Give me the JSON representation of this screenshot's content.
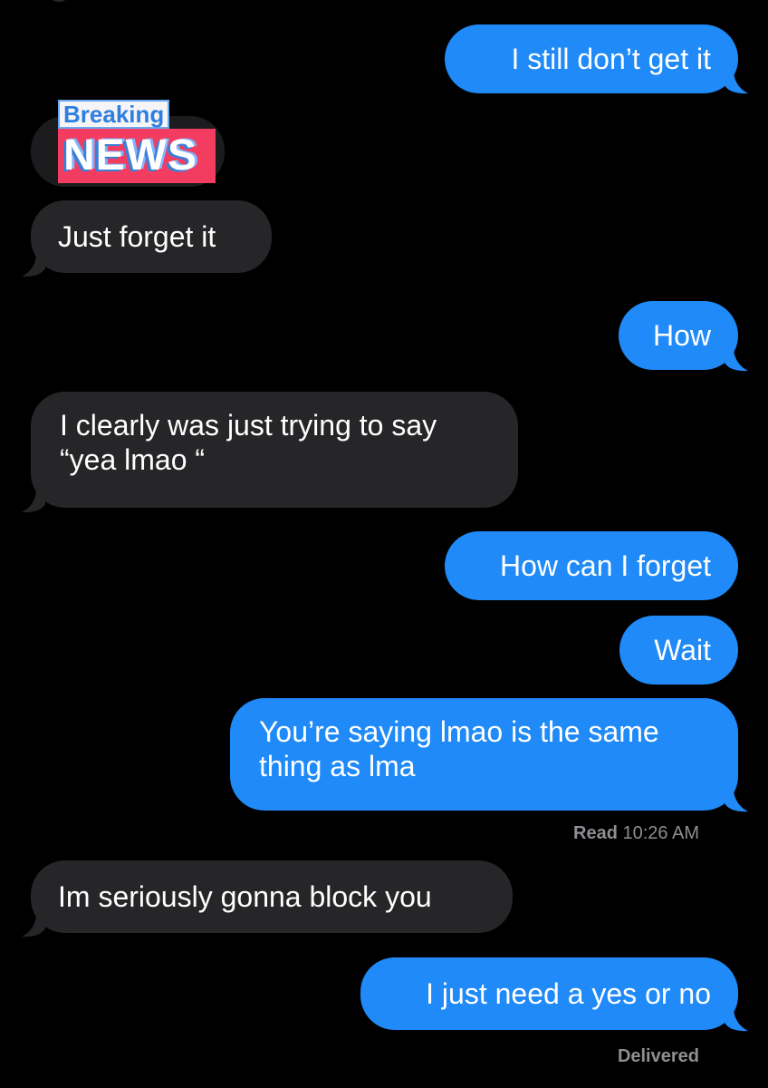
{
  "messages": [
    {
      "id": "m1",
      "direction": "outgoing",
      "text": "I still don’t get it"
    },
    {
      "id": "m2",
      "direction": "incoming",
      "text": "Just forget it"
    },
    {
      "id": "m3",
      "direction": "outgoing",
      "text": "How"
    },
    {
      "id": "m4",
      "direction": "incoming",
      "text": "I clearly was just trying to say “yea lmao “"
    },
    {
      "id": "m5",
      "direction": "outgoing",
      "text": "How can I forget"
    },
    {
      "id": "m6",
      "direction": "outgoing",
      "text": "Wait"
    },
    {
      "id": "m7",
      "direction": "outgoing",
      "text": "You’re saying lmao is the same thing as lma"
    },
    {
      "id": "m8",
      "direction": "incoming",
      "text": "Im seriously gonna block you"
    },
    {
      "id": "m9",
      "direction": "outgoing",
      "text": "I just need a yes or no"
    }
  ],
  "sticker": {
    "top_text": "Breaking",
    "bottom_text": "NEWS"
  },
  "receipts": {
    "read_label": "Read",
    "read_time": "10:26 AM",
    "delivered_label": "Delivered"
  },
  "colors": {
    "background": "#000000",
    "outgoing_bubble": "#1f8af8",
    "incoming_bubble": "#262628",
    "status_text": "#8e8e93",
    "sticker_red": "#f23d61"
  }
}
